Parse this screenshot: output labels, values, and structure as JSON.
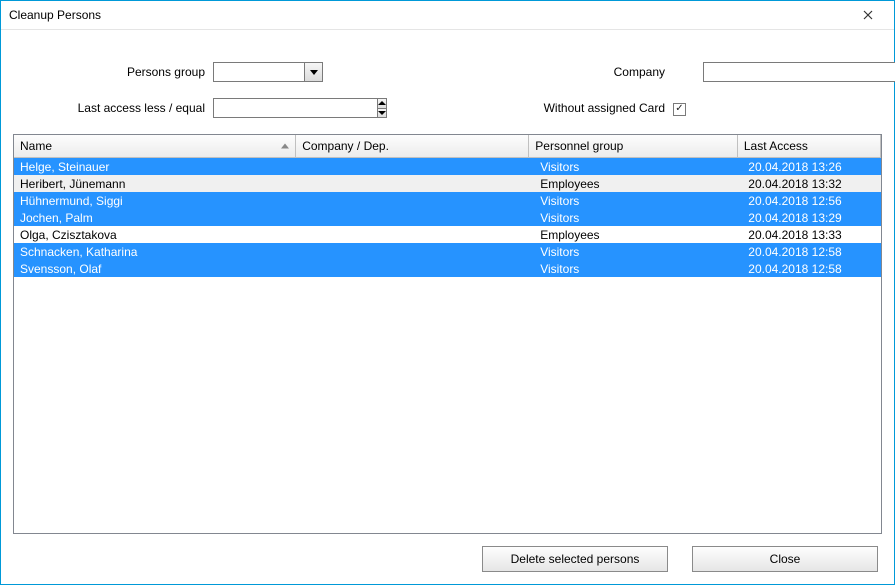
{
  "window": {
    "title": "Cleanup Persons"
  },
  "filters": {
    "persons_group_label": "Persons group",
    "persons_group_value": "",
    "last_access_label": "Last access less / equal",
    "last_access_value": "",
    "company_label": "Company",
    "company_value": "",
    "without_card_label": "Without assigned Card",
    "without_card_checked": true
  },
  "table": {
    "columns": [
      {
        "key": "name",
        "label": "Name",
        "width": "33%",
        "sorted": true
      },
      {
        "key": "company_dep",
        "label": "Company / Dep.",
        "width": "27%"
      },
      {
        "key": "pers_group",
        "label": "Personnel group",
        "width": "24%"
      },
      {
        "key": "last_access",
        "label": "Last Access",
        "width": "16%"
      }
    ],
    "rows": [
      {
        "name": "Helge, Steinauer",
        "company_dep": "",
        "pers_group": "Visitors",
        "last_access": "20.04.2018 13:26",
        "selected": true
      },
      {
        "name": "Heribert, Jünemann",
        "company_dep": "",
        "pers_group": "Employees",
        "last_access": "20.04.2018 13:32",
        "selected": false,
        "alt": true
      },
      {
        "name": "Hühnermund, Siggi",
        "company_dep": "",
        "pers_group": "Visitors",
        "last_access": "20.04.2018 12:56",
        "selected": true
      },
      {
        "name": "Jochen, Palm",
        "company_dep": "",
        "pers_group": "Visitors",
        "last_access": "20.04.2018 13:29",
        "selected": true
      },
      {
        "name": "Olga, Czisztakova",
        "company_dep": "",
        "pers_group": "Employees",
        "last_access": "20.04.2018 13:33",
        "selected": false
      },
      {
        "name": "Schnacken, Katharina",
        "company_dep": "",
        "pers_group": "Visitors",
        "last_access": "20.04.2018 12:58",
        "selected": true
      },
      {
        "name": "Svensson, Olaf",
        "company_dep": "",
        "pers_group": "Visitors",
        "last_access": "20.04.2018 12:58",
        "selected": true
      }
    ]
  },
  "buttons": {
    "delete": "Delete selected persons",
    "close": "Close"
  }
}
